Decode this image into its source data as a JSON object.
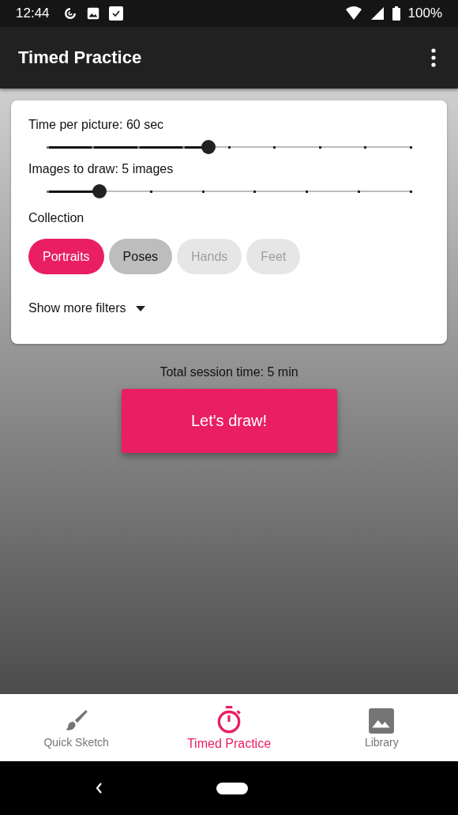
{
  "status_bar": {
    "time": "12:44",
    "battery": "100%"
  },
  "app_bar": {
    "title": "Timed Practice"
  },
  "settings": {
    "sliders": [
      {
        "kind": "time",
        "label": "Time per picture:",
        "reading": "60 sec",
        "level": 0.444
      },
      {
        "kind": "count",
        "label": "Images to draw:",
        "reading": "5 images",
        "level": 0.143
      }
    ],
    "collection_label": "Collection",
    "chips": [
      {
        "label": "Portraits",
        "selected": true,
        "disabled": false
      },
      {
        "label": "Poses",
        "selected": false,
        "disabled": false
      },
      {
        "label": "Hands",
        "selected": false,
        "disabled": true
      },
      {
        "label": "Feet",
        "selected": false,
        "disabled": true
      }
    ],
    "more_filters": {
      "label": "Show more filters",
      "expanded": false
    }
  },
  "session_time": "Total session time: 5 min",
  "start_button": "Let's draw!",
  "bottom_nav": [
    {
      "kind": "brush",
      "label": "Quick Sketch",
      "selected": false
    },
    {
      "kind": "timer",
      "label": "Timed Practice",
      "selected": true
    },
    {
      "kind": "image",
      "label": "Library",
      "selected": false
    }
  ]
}
